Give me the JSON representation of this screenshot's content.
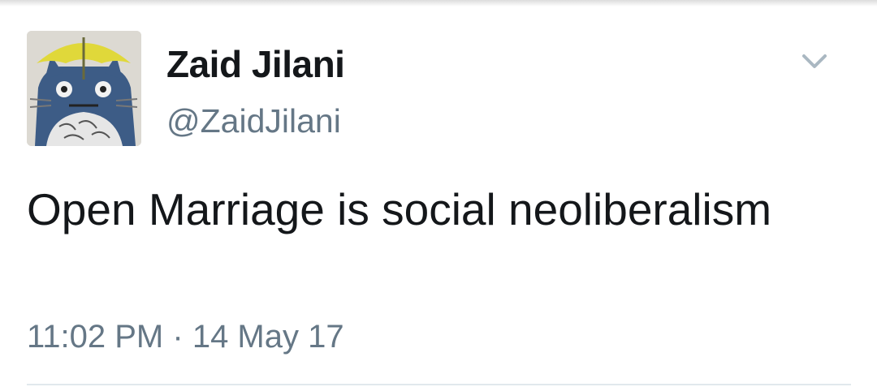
{
  "tweet": {
    "display_name": "Zaid Jilani",
    "handle": "@ZaidJilani",
    "text": "Open Marriage is social neoliberalism",
    "time": "11:02 PM",
    "separator": "·",
    "date": "14 May 17"
  },
  "icons": {
    "menu": "chevron-down-icon",
    "avatar": "avatar"
  },
  "colors": {
    "name": "#14171a",
    "secondary": "#657786",
    "divider": "#e1e8ed",
    "chevron": "#aab8c2"
  }
}
